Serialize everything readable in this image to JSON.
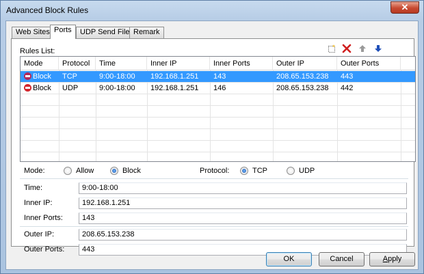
{
  "window": {
    "title": "Advanced Block Rules",
    "close": "✕"
  },
  "tabs": [
    {
      "label": "Web Sites",
      "active": false
    },
    {
      "label": "Ports",
      "active": true
    },
    {
      "label": "UDP Send File",
      "active": false
    },
    {
      "label": "Remark",
      "active": false
    }
  ],
  "rules": {
    "label": "Rules List:",
    "toolbar": {
      "new_icon": "new-icon",
      "delete_icon": "delete-icon",
      "up_icon": "arrow-up-icon",
      "down_icon": "arrow-down-icon"
    },
    "columns": [
      "Mode",
      "Protocol",
      "Time",
      "Inner IP",
      "Inner Ports",
      "Outer IP",
      "Outer Ports"
    ],
    "rows": [
      {
        "mode": "Block",
        "protocol": "TCP",
        "time": "9:00-18:00",
        "inner_ip": "192.168.1.251",
        "inner_ports": "143",
        "outer_ip": "208.65.153.238",
        "outer_ports": "443",
        "selected": true
      },
      {
        "mode": "Block",
        "protocol": "UDP",
        "time": "9:00-18:00",
        "inner_ip": "192.168.1.251",
        "inner_ports": "146",
        "outer_ip": "208.65.153.238",
        "outer_ports": "442",
        "selected": false
      }
    ]
  },
  "form": {
    "mode_label": "Mode:",
    "mode_allow": "Allow",
    "mode_block": "Block",
    "protocol_label": "Protocol:",
    "protocol_tcp": "TCP",
    "protocol_udp": "UDP",
    "time_label": "Time:",
    "time_value": "9:00-18:00",
    "inner_ip_label": "Inner IP:",
    "inner_ip_value": "192.168.1.251",
    "inner_ports_label": "Inner Ports:",
    "inner_ports_value": "143",
    "outer_ip_label": "Outer IP:",
    "outer_ip_value": "208.65.153.238",
    "outer_ports_label": "Outer Ports:",
    "outer_ports_value": "443"
  },
  "buttons": {
    "ok": "OK",
    "cancel": "Cancel",
    "apply_underline": "A",
    "apply_rest": "pply"
  },
  "colors": {
    "selection": "#3399ff",
    "block_icon": "#d3242b",
    "delete_icon": "#d01f1f",
    "down_arrow": "#1f4fb8"
  }
}
